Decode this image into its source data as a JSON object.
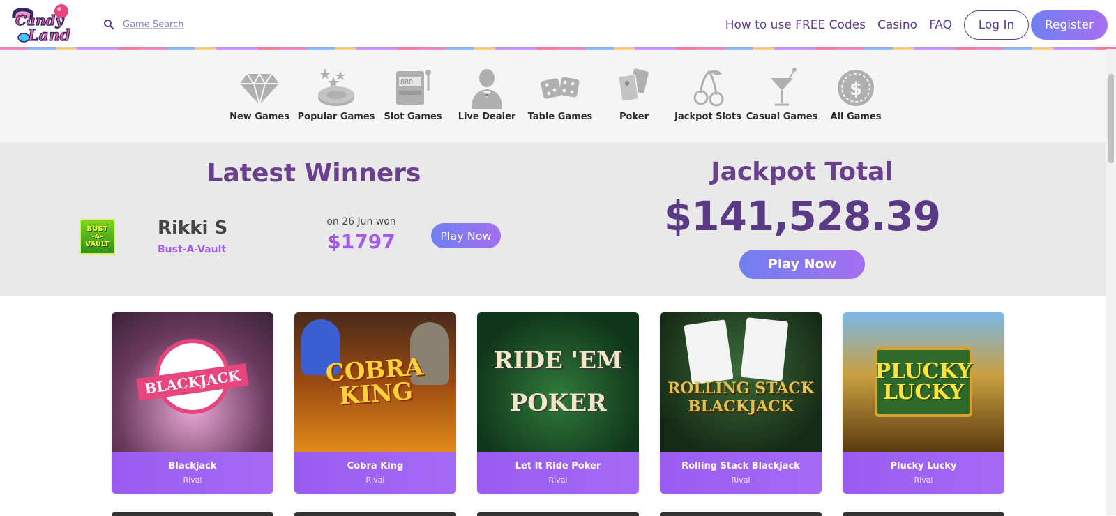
{
  "header": {
    "logo_text": "Candy Land",
    "search_label": "Game Search",
    "nav_links": [
      "How to use FREE Codes",
      "Casino",
      "FAQ"
    ],
    "login_label": "Log In",
    "register_label": "Register"
  },
  "categories": [
    {
      "label": "New Games",
      "icon": "diamond-icon"
    },
    {
      "label": "Popular Games",
      "icon": "star-chips-icon"
    },
    {
      "label": "Slot Games",
      "icon": "slot-machine-icon"
    },
    {
      "label": "Live Dealer",
      "icon": "dealer-icon"
    },
    {
      "label": "Table Games",
      "icon": "dice-icon"
    },
    {
      "label": "Poker",
      "icon": "cards-icon"
    },
    {
      "label": "Jackpot Slots",
      "icon": "cherry-icon"
    },
    {
      "label": "Casual Games",
      "icon": "cocktail-icon"
    },
    {
      "label": "All Games",
      "icon": "dollar-coin-icon"
    }
  ],
  "winners": {
    "title": "Latest Winners",
    "thumb_text": [
      "BUST",
      "-A-",
      "VAULT"
    ],
    "name": "Rikki S",
    "game": "Bust-A-Vault",
    "date_text": "on 26 Jun won",
    "amount": "$1797",
    "play_label": "Play Now"
  },
  "jackpot": {
    "title": "Jackpot Total",
    "amount": "$141,528.39",
    "play_label": "Play Now"
  },
  "games": [
    {
      "name": "Blackjack",
      "provider": "Rival",
      "art_text": "BLACKJACK"
    },
    {
      "name": "Cobra King",
      "provider": "Rival",
      "art_text": "COBRA KING"
    },
    {
      "name": "Let It Ride Poker",
      "provider": "Rival",
      "art_text": "RIDE 'EM POKER"
    },
    {
      "name": "Rolling Stack Blackjack",
      "provider": "Rival",
      "art_text": "ROLLING STACK BLACKJACK"
    },
    {
      "name": "Plucky Lucky",
      "provider": "Rival",
      "art_text": "PLUCKY LUCKY"
    }
  ],
  "colors": {
    "brand_purple": "#6a3f8c",
    "accent_violet": "#a35ce8",
    "button_gradient_start": "#6f7ff0",
    "button_gradient_end": "#a56ff0"
  }
}
